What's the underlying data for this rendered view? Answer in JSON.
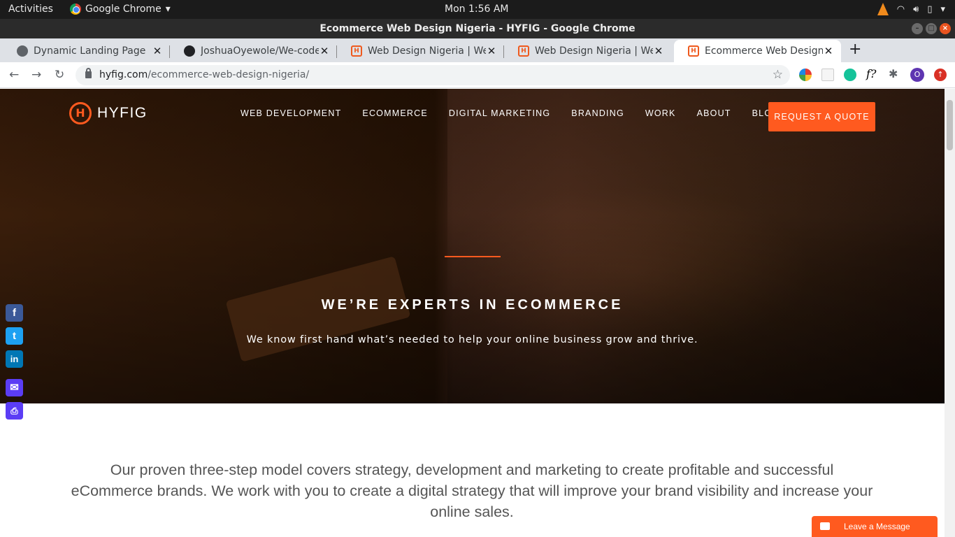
{
  "system": {
    "activities": "Activities",
    "app_menu": "Google Chrome",
    "clock": "Mon  1:56 AM"
  },
  "window": {
    "title": "Ecommerce Web Design Nigeria - HYFIG - Google Chrome"
  },
  "tabs": [
    {
      "label": "Dynamic Landing Page",
      "icon": "globe-icon"
    },
    {
      "label": "JoshuaOyewole/We-code",
      "icon": "github-icon"
    },
    {
      "label": "Web Design Nigeria | Web",
      "icon": "hyfig-icon"
    },
    {
      "label": "Web Design Nigeria | Web",
      "icon": "hyfig-icon"
    },
    {
      "label": "Ecommerce Web Design N",
      "icon": "hyfig-icon",
      "active": true
    }
  ],
  "omnibox": {
    "host": "hyfig.com",
    "path": "/ecommerce-web-design-nigeria/"
  },
  "site": {
    "logo_text": "HYFIG",
    "nav": [
      "WEB DEVELOPMENT",
      "ECOMMERCE",
      "DIGITAL MARKETING",
      "BRANDING",
      "WORK",
      "ABOUT",
      "BLOG"
    ],
    "cta": "REQUEST A QUOTE",
    "hero_title": "WE’RE EXPERTS IN ECOMMERCE",
    "hero_subtitle": "We know first hand what’s needed to help your online business grow and thrive.",
    "intro": "Our proven three-step model covers strategy, development and marketing to create profitable and successful eCommerce brands. We work with you to create a digital strategy that will improve your brand visibility and increase your online sales.",
    "share": [
      "facebook-icon",
      "twitter-icon",
      "linkedin-icon",
      "email-icon",
      "print-icon"
    ],
    "livechat": "Leave a Message"
  },
  "colors": {
    "brand_orange": "#ff5a1f",
    "share_blue": "#3b5998",
    "share_twitter": "#1da1f2",
    "share_linkedin": "#0077b5",
    "share_purple": "#5b3df5"
  }
}
